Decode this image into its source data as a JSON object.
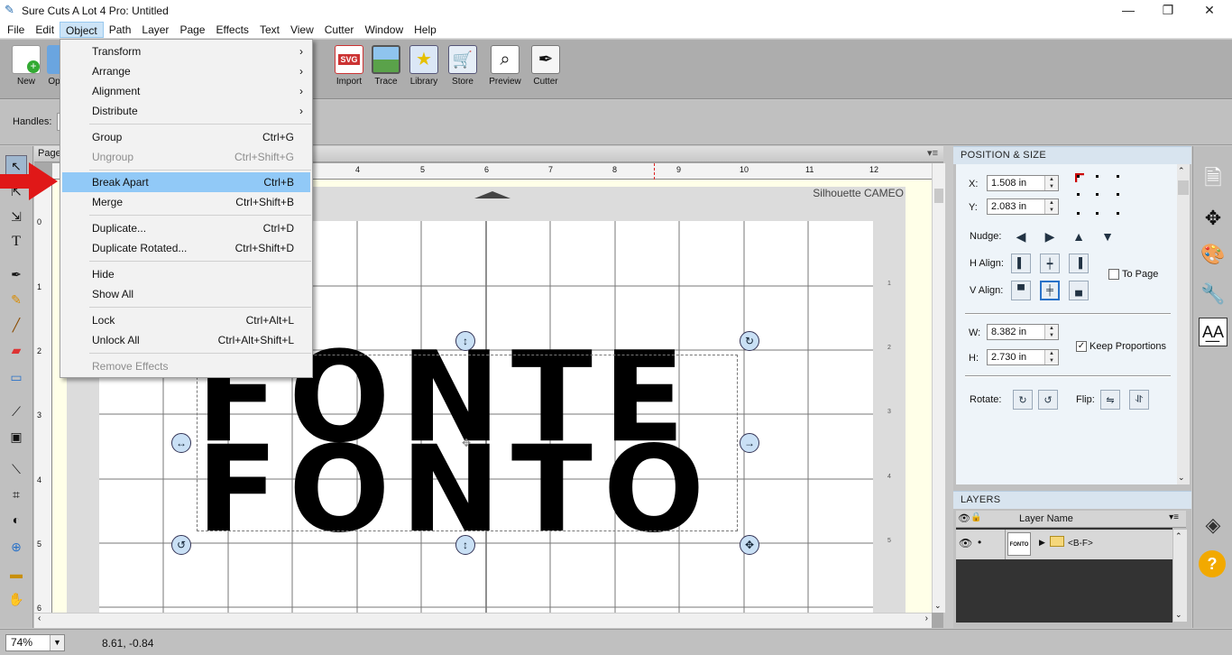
{
  "window": {
    "title": "Sure Cuts A Lot 4 Pro: Untitled",
    "minimize": "—",
    "maximize": "❐",
    "close": "✕"
  },
  "menubar": [
    "File",
    "Edit",
    "Object",
    "Path",
    "Layer",
    "Page",
    "Effects",
    "Text",
    "View",
    "Cutter",
    "Window",
    "Help"
  ],
  "toolbar": {
    "buttons": [
      {
        "label": "New",
        "icon": "new-doc-icon"
      },
      {
        "label": "Op",
        "icon": "open-icon"
      },
      {
        "label": "Import",
        "icon": "svg-import-icon"
      },
      {
        "label": "Trace",
        "icon": "trace-icon"
      },
      {
        "label": "Library",
        "icon": "library-star-icon"
      },
      {
        "label": "Store",
        "icon": "store-cart-icon"
      },
      {
        "label": "Preview",
        "icon": "magnifier-preview-icon"
      },
      {
        "label": "Cutter",
        "icon": "cutter-knife-icon"
      }
    ]
  },
  "optionsbar": {
    "handles_label": "Handles:"
  },
  "document": {
    "tab_label": "Page",
    "cutter_name": "Silhouette CAMEO",
    "ruler_h": [
      "4",
      "5",
      "6",
      "7",
      "8",
      "9",
      "10",
      "11",
      "12"
    ],
    "ruler_v": [
      "0",
      "1",
      "2",
      "3",
      "4",
      "5",
      "6"
    ],
    "inner_ruler_v": [
      "1",
      "2",
      "3",
      "4",
      "5"
    ]
  },
  "object_menu": {
    "items": [
      {
        "label": "Transform",
        "submenu": true
      },
      {
        "label": "Arrange",
        "submenu": true
      },
      {
        "label": "Alignment",
        "submenu": true
      },
      {
        "label": "Distribute",
        "submenu": true
      },
      {
        "label": "Group",
        "shortcut": "Ctrl+G"
      },
      {
        "label": "Ungroup",
        "shortcut": "Ctrl+Shift+G",
        "disabled": true
      },
      {
        "label": "Break Apart",
        "shortcut": "Ctrl+B",
        "highlighted": true
      },
      {
        "label": "Merge",
        "shortcut": "Ctrl+Shift+B"
      },
      {
        "label": "Duplicate...",
        "shortcut": "Ctrl+D"
      },
      {
        "label": "Duplicate Rotated...",
        "shortcut": "Ctrl+Shift+D"
      },
      {
        "label": "Hide"
      },
      {
        "label": "Show All"
      },
      {
        "label": "Lock",
        "shortcut": "Ctrl+Alt+L"
      },
      {
        "label": "Unlock All",
        "shortcut": "Ctrl+Alt+Shift+L"
      },
      {
        "label": "Remove Effects",
        "disabled": true
      }
    ]
  },
  "position_size": {
    "title": "POSITION & SIZE",
    "x_label": "X:",
    "x_value": "1.508 in",
    "y_label": "Y:",
    "y_value": "2.083 in",
    "nudge_label": "Nudge:",
    "halign_label": "H Align:",
    "valign_label": "V Align:",
    "to_page_label": "To Page",
    "w_label": "W:",
    "w_value": "8.382 in",
    "h_label": "H:",
    "h_value": "2.730 in",
    "keep_proportions_label": "Keep Proportions",
    "keep_proportions": true,
    "rotate_label": "Rotate:",
    "flip_label": "Flip:"
  },
  "layers": {
    "title": "LAYERS",
    "column_name": "Layer Name",
    "row_name": "<B-F>",
    "row_dot": "•",
    "thumb_text": "FONTO"
  },
  "artwork_text": {
    "line1": "FONTE",
    "line2": "FONTO"
  },
  "status": {
    "zoom": "74%",
    "coords": "8.61, -0.84"
  },
  "colors": {
    "highlight": "#91c9f7",
    "arrow": "#e01818",
    "panel_title": "#d8e4ef"
  }
}
